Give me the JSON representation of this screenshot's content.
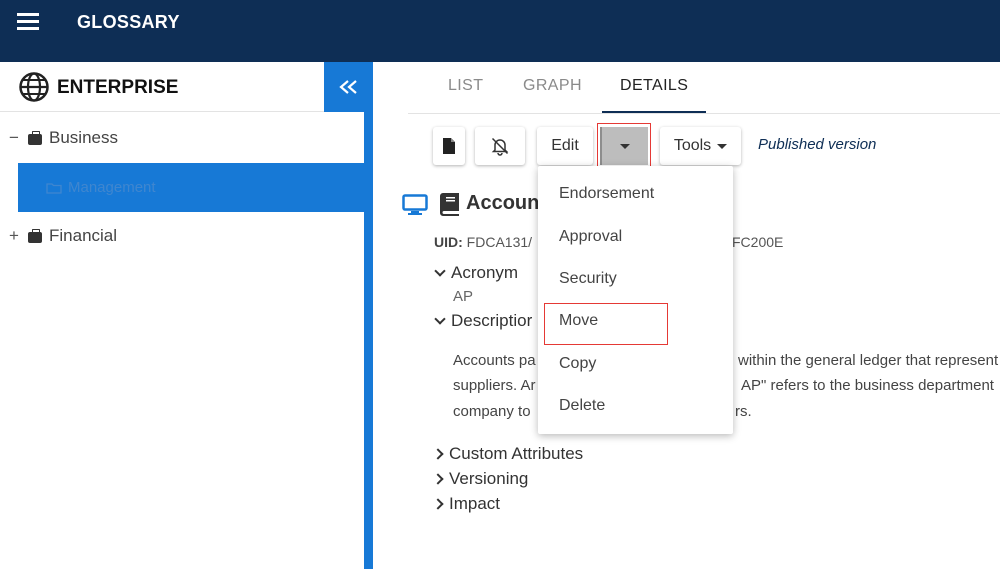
{
  "header": {
    "title": "GLOSSARY"
  },
  "sidebar": {
    "title": "ENTERPRISE",
    "tree": [
      {
        "toggle": "−",
        "label": "Business"
      },
      {
        "label": "Management"
      },
      {
        "toggle": "+",
        "label": "Financial"
      }
    ]
  },
  "tabs": [
    "LIST",
    "GRAPH",
    "DETAILS"
  ],
  "toolbar": {
    "edit_label": "Edit",
    "tools_label": "Tools",
    "published": "Published version"
  },
  "dropdown": {
    "items": [
      "Endorsement",
      "Approval",
      "Security",
      "Move",
      "Copy",
      "Delete"
    ]
  },
  "details": {
    "title": "Accoun",
    "uid_label": "UID:",
    "uid_value": "FDCA131/",
    "uid_suffix": "FC200E",
    "acronym_label": "Acronym",
    "acronym_value": "AP",
    "description_label": "Descriptior",
    "description_lines_left": [
      "Accounts pa",
      "suppliers. Ar",
      "company to"
    ],
    "description_lines_right": [
      "within the general ledger that represent",
      "AP\" refers to the business department",
      "rs."
    ],
    "sections": [
      "Custom Attributes",
      "Versioning",
      "Impact"
    ]
  },
  "colors": {
    "header_bg": "#0e2e55",
    "accent": "#1779d6",
    "highlight": "#e53935"
  }
}
